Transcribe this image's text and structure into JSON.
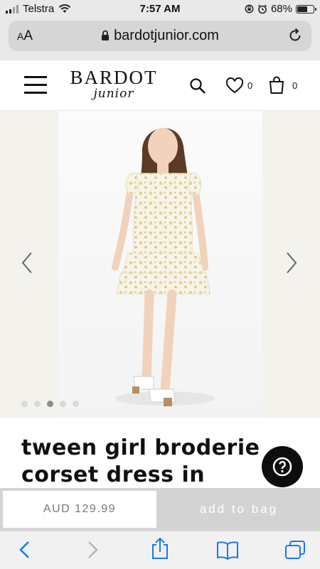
{
  "status_bar": {
    "carrier": "Telstra",
    "time": "7:57 AM",
    "battery_percent": "68%",
    "battery_level": 0.68
  },
  "address_bar": {
    "text_size_label": "AA",
    "url": "bardotjunior.com"
  },
  "header": {
    "brand": "BARDOT",
    "brand_sub": "junior",
    "wishlist_count": "0",
    "bag_count": "0"
  },
  "hero": {
    "slide_count": 5,
    "active_slide": 3
  },
  "product": {
    "title": "tween girl broderie corset dress in"
  },
  "purchase": {
    "price": "AUD 129.99",
    "add_to_bag": "add to bag"
  },
  "colors": {
    "accent_dark": "#0d0d0d",
    "add_to_bag_bg": "#d3d3d3",
    "hero_bg": "#f4f2ed"
  },
  "icons": [
    "signal-icon",
    "wifi-icon",
    "lock-rotation-icon",
    "alarm-icon",
    "battery-icon",
    "lock-icon",
    "reload-icon",
    "menu-icon",
    "search-icon",
    "heart-icon",
    "bag-icon",
    "chevron-left-icon",
    "chevron-right-icon",
    "help-icon",
    "back-icon",
    "forward-icon",
    "share-icon",
    "bookmarks-icon",
    "tabs-icon"
  ]
}
